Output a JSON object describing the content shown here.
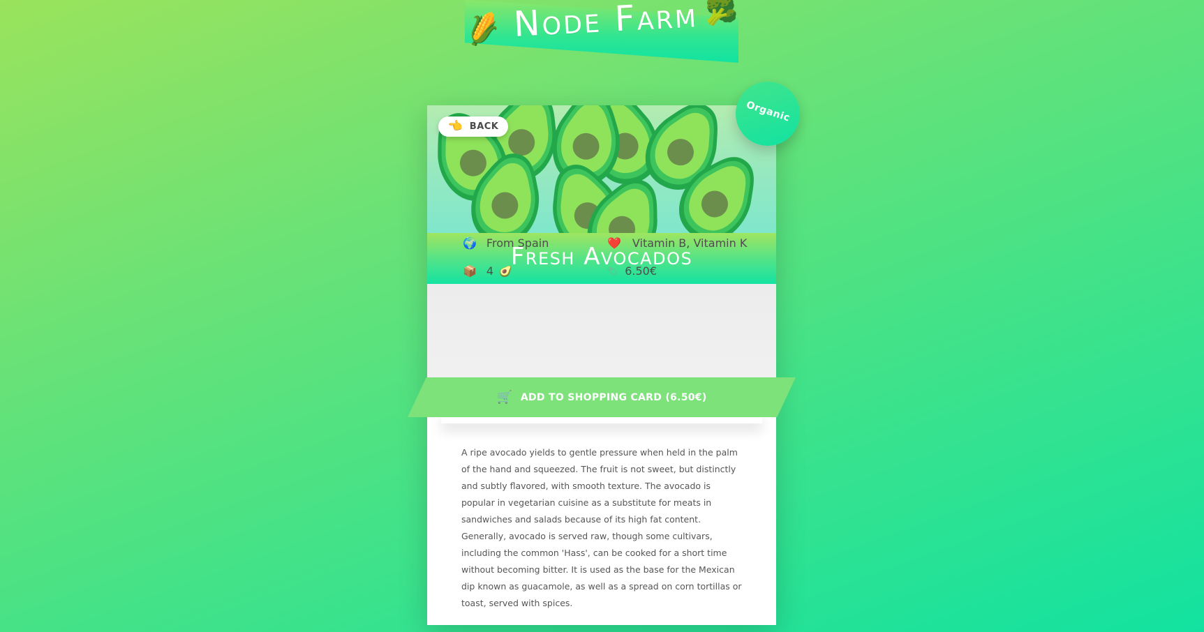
{
  "header": {
    "site_title": "Node Farm",
    "left_icon": "corn-icon",
    "right_icon": "broccoli-icon",
    "left_glyph": "🌽",
    "right_glyph": "🥦"
  },
  "product": {
    "badge": "Organic",
    "back_label": "BACK",
    "back_glyph": "👈",
    "title": "Fresh Avocados",
    "origin_glyph": "🌍",
    "origin": "From Spain",
    "nutrients_glyph": "❤️",
    "nutrients": "Vitamin B, Vitamin K",
    "quantity_glyph": "📦",
    "quantity": "4",
    "quantity_fruit_glyph": "🥑",
    "price_glyph": "🏷",
    "price": "6.50€",
    "cart_glyph": "🛒",
    "cart_label": "ADD TO SHOPPING CARD (6.50€)",
    "description": "A ripe avocado yields to gentle pressure when held in the palm of the hand and squeezed. The fruit is not sweet, but distinctly and subtly flavored, with smooth texture. The avocado is popular in vegetarian cuisine as a substitute for meats in sandwiches and salads because of its high fat content. Generally, avocado is served raw, though some cultivars, including the common 'Hass', can be cooked for a short time without becoming bitter. It is used as the base for the Mexican dip known as guacamole, as well as a spread on corn tortillas or toast, served with spices."
  },
  "colors": {
    "accent_green": "#7de27a",
    "teal": "#12e2a2",
    "text_dark": "#4d4d4d"
  }
}
